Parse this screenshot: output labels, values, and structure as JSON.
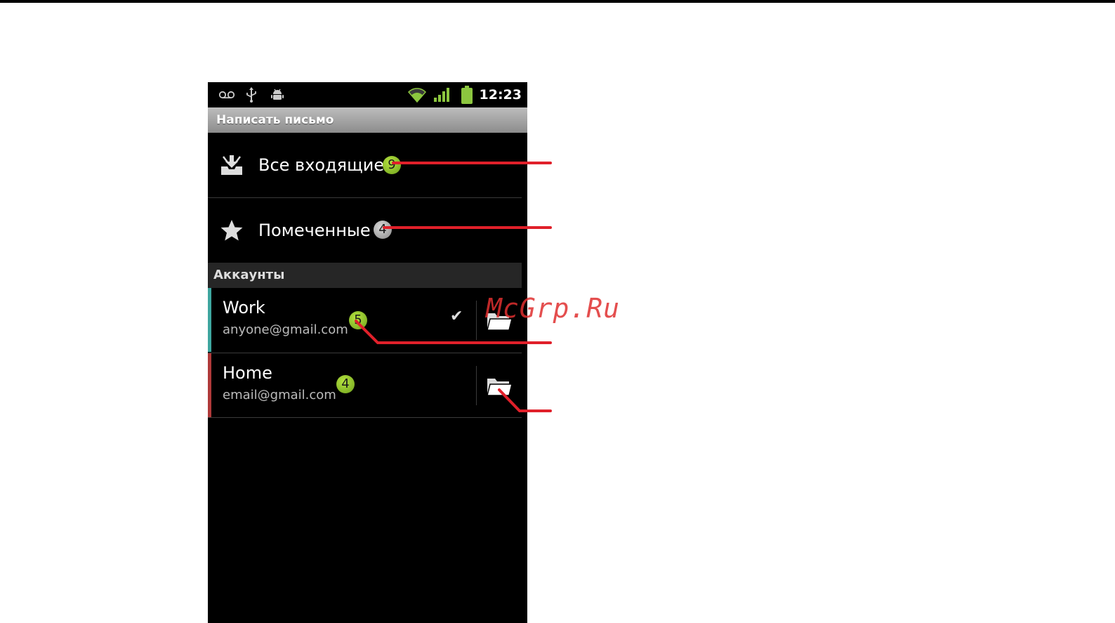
{
  "status_bar": {
    "time": "12:23",
    "icons": [
      "voicemail-icon",
      "usb-icon",
      "android-debug-icon",
      "wifi-icon",
      "signal-icon",
      "battery-icon"
    ]
  },
  "title_bar": {
    "title": "Написать письмо"
  },
  "combined": [
    {
      "label": "Все входящие",
      "count": "9",
      "icon": "inbox-icon",
      "badge_color": "green"
    },
    {
      "label": "Помеченные",
      "count": "4",
      "icon": "star-icon",
      "badge_color": "gray"
    }
  ],
  "accounts_header": "Аккаунты",
  "accounts": [
    {
      "name": "Work",
      "email": "anyone@gmail.com",
      "count": "5",
      "stripe_color": "#3fa7a0",
      "selected": true
    },
    {
      "name": "Home",
      "email": "email@gmail.com",
      "count": "4",
      "stripe_color": "#b03a3a",
      "selected": false
    }
  ],
  "watermark": "McGrp.Ru",
  "colors": {
    "callout": "#e0202a",
    "badge_green": "#8cc63f",
    "badge_gray": "#b0b0b0"
  }
}
